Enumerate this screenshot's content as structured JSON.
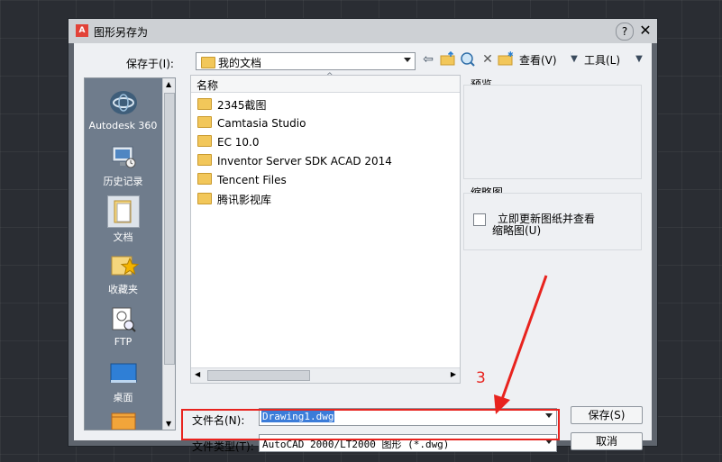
{
  "window": {
    "title": "图形另存为",
    "help": "?",
    "close": "✕",
    "app_icon_letter": "A"
  },
  "toolbar": {
    "save_in_label": "保存于(I):",
    "save_in_value": "我的文档",
    "view_label": "查看(V)",
    "tools_label": "工具(L)"
  },
  "places": [
    {
      "label": "Autodesk 360",
      "icon": "autodesk-360-icon"
    },
    {
      "label": "历史记录",
      "icon": "history-icon"
    },
    {
      "label": "文档",
      "icon": "documents-icon"
    },
    {
      "label": "收藏夹",
      "icon": "favorites-icon"
    },
    {
      "label": "FTP",
      "icon": "ftp-icon"
    },
    {
      "label": "桌面",
      "icon": "desktop-icon"
    }
  ],
  "filelist": {
    "column_name": "名称",
    "items": [
      "2345截图",
      "Camtasia Studio",
      "EC 10.0",
      "Inventor Server SDK ACAD 2014",
      "Tencent Files",
      "腾讯影视库"
    ]
  },
  "preview": {
    "label": "预览"
  },
  "thumbnail": {
    "label": "缩略图",
    "checkbox_text_1": "立即更新图纸并查看",
    "checkbox_text_2": "缩略图(U)",
    "checked": false
  },
  "filename": {
    "label": "文件名(N):",
    "value": "Drawing1.dwg"
  },
  "filetype": {
    "label": "文件类型(T):",
    "value": "AutoCAD 2000/LT2000 图形 (*.dwg)"
  },
  "buttons": {
    "save": "保存(S)",
    "cancel": "取消"
  },
  "annotation": {
    "step_number": "3",
    "color": "#e8231e"
  }
}
